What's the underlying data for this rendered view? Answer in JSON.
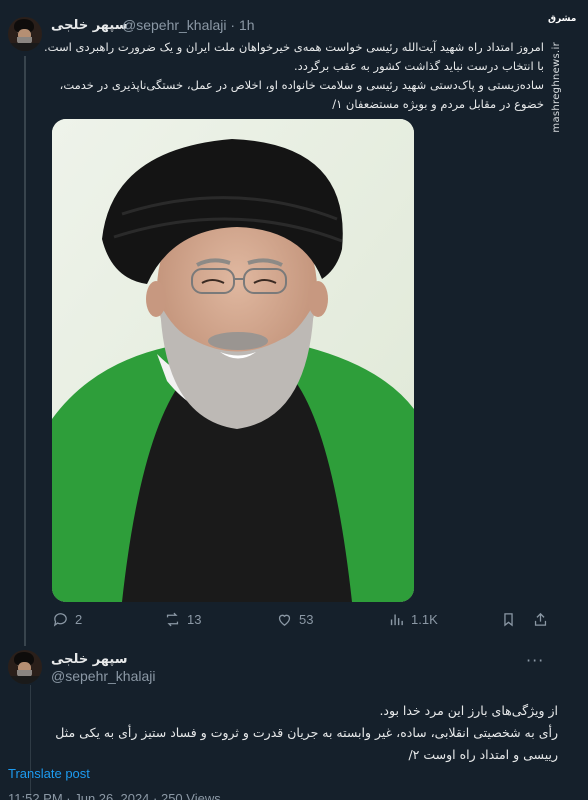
{
  "tweet1": {
    "author_name": "سپهر خلجی",
    "handle": "@sepehr_khalaji",
    "separator": "·",
    "time": "1h",
    "lines": [
      "امروز امتداد راه شهید آیت‌الله رئیسی خواست همه‌ی خیرخواهان ملت ایران و یک ضرورت راهبردی است.",
      "با انتخاب درست نباید گذاشت کشور به عقب برگردد.",
      "ساده‌زیستی و پاک‌دستی شهید رئیسی و سلامت خانواده او، اخلاص در عمل، خستگی‌ناپذیری در خدمت،",
      "خضوع در مقابل مردم و بویژه مستضعفان ۱/"
    ],
    "actions": {
      "replies": "2",
      "retweets": "13",
      "likes": "53",
      "views": "1.1K"
    }
  },
  "tweet2": {
    "author_name": "سپهر خلجی",
    "handle": "@sepehr_khalaji",
    "lines": [
      "از ویژگی‌های بارز این مرد خدا بود.",
      "رأی به شخصیتی انقلابی، ساده، غیر وابسته به جریان قدرت و ثروت و فساد ستیز رأی به یکی مثل",
      "رییسی و امتداد راه اوست ۲/"
    ],
    "translate_label": "Translate post",
    "meta": "11:52 PM · Jun 26, 2024 · 250 Views"
  },
  "watermark": {
    "logo": "مشرق",
    "site": "mashreghnews.ir"
  },
  "colors": {
    "background": "#15202b",
    "text": "#e7e9ea",
    "muted": "#8b98a5",
    "link": "#1d9bf0"
  },
  "icons": [
    "reply-icon",
    "retweet-icon",
    "like-icon",
    "views-icon",
    "share-icon",
    "more-icon"
  ]
}
